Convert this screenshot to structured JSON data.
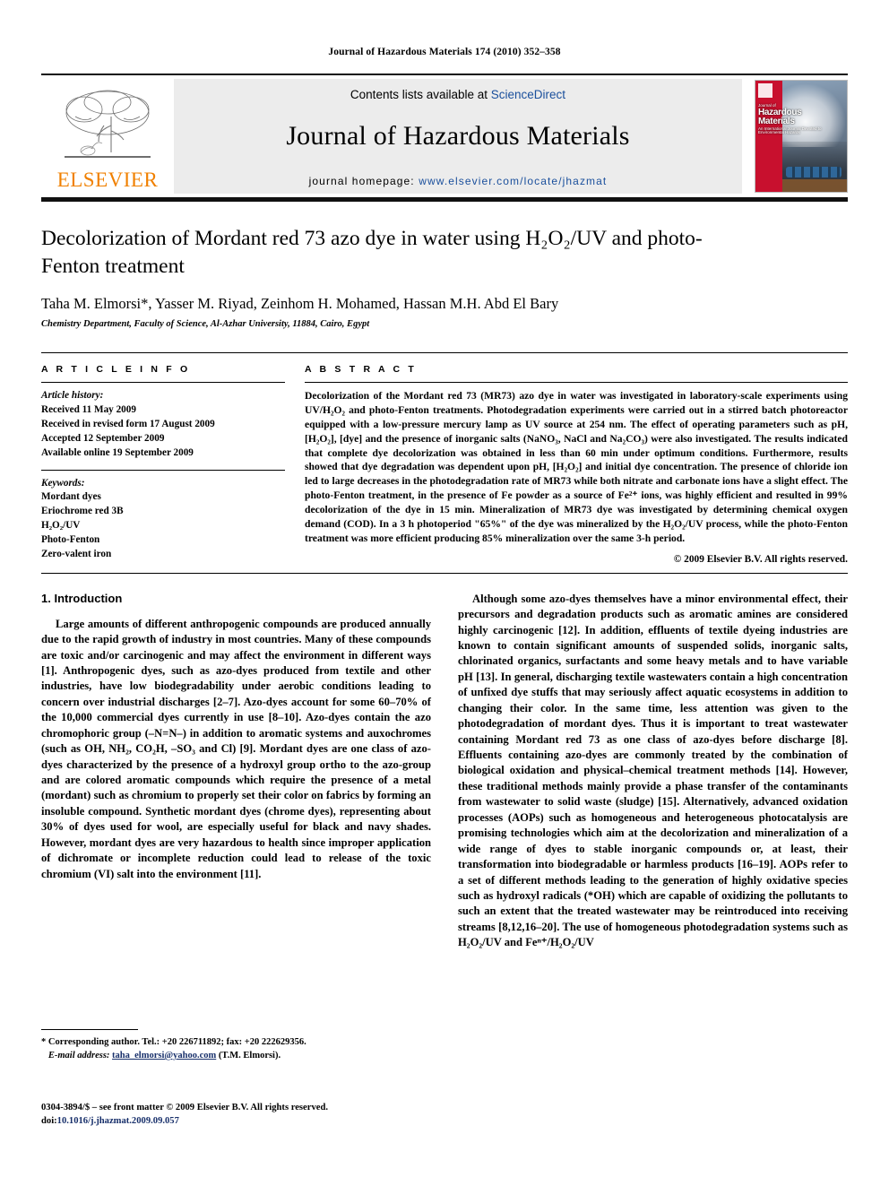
{
  "running_head": "Journal of Hazardous Materials 174 (2010) 352–358",
  "masthead": {
    "publisher_name": "ELSEVIER",
    "contents_prefix": "Contents lists available at",
    "contents_link": "ScienceDirect",
    "journal_title": "Journal of Hazardous Materials",
    "homepage_label": "journal homepage:",
    "homepage_url": "www.elsevier.com/locate/jhazmat",
    "cover_journal_of": "Journal of",
    "cover_line1": "Hazardous",
    "cover_line2": "Materials",
    "cover_sub": "An International Journal Devoted to Environmental Hazards",
    "link_color": "#1a4f9c",
    "elsevier_orange": "#f08000",
    "band_gray": "#ececec"
  },
  "article": {
    "title": "Decolorization of Mordant red 73 azo dye in water using H₂O₂/UV and photo-Fenton treatment",
    "authors": "Taha M. Elmorsi*, Yasser M. Riyad, Zeinhom H. Mohamed, Hassan M.H. Abd El Bary",
    "affiliation": "Chemistry Department, Faculty of Science, Al-Azhar University, 11884, Cairo, Egypt"
  },
  "info": {
    "heading": "A R T I C L E    I N F O",
    "history_label": "Article history:",
    "history": [
      "Received 11 May 2009",
      "Received in revised form 17 August 2009",
      "Accepted 12 September 2009",
      "Available online 19 September 2009"
    ],
    "keywords_label": "Keywords:",
    "keywords": [
      "Mordant dyes",
      "Eriochrome red 3B",
      "H₂O₂/UV",
      "Photo-Fenton",
      "Zero-valent iron"
    ]
  },
  "abstract": {
    "heading": "A B S T R A C T",
    "text": "Decolorization of the Mordant red 73 (MR73) azo dye in water was investigated in laboratory-scale experiments using UV/H₂O₂ and photo-Fenton treatments. Photodegradation experiments were carried out in a stirred batch photoreactor equipped with a low-pressure mercury lamp as UV source at 254 nm. The effect of operating parameters such as pH, [H₂O₂], [dye] and the presence of inorganic salts (NaNO₃, NaCl and Na₂CO₃) were also investigated. The results indicated that complete dye decolorization was obtained in less than 60 min under optimum conditions. Furthermore, results showed that dye degradation was dependent upon pH, [H₂O₂] and initial dye concentration. The presence of chloride ion led to large decreases in the photodegradation rate of MR73 while both nitrate and carbonate ions have a slight effect. The photo-Fenton treatment, in the presence of Fe powder as a source of Fe²⁺ ions, was highly efficient and resulted in 99% decolorization of the dye in 15 min. Mineralization of MR73 dye was investigated by determining chemical oxygen demand (COD). In a 3 h photoperiod \"65%\" of the dye was mineralized by the H₂O₂/UV process, while the photo-Fenton treatment was more efficient producing 85% mineralization over the same 3-h period.",
    "copyright": "© 2009 Elsevier B.V. All rights reserved."
  },
  "section": {
    "number_title": "1.  Introduction",
    "left_paragraph_1": "Large amounts of different anthropogenic compounds are produced annually due to the rapid growth of industry in most countries. Many of these compounds are toxic and/or carcinogenic and may affect the environment in different ways [1]. Anthropogenic dyes, such as azo-dyes produced from textile and other industries, have low biodegradability under aerobic conditions leading to concern over industrial discharges [2–7]. Azo-dyes account for some 60–70% of the 10,000 commercial dyes currently in use [8–10]. Azo-dyes contain the azo chromophoric group (–N=N–) in addition to aromatic systems and auxochromes (such as OH, NH₂, CO₂H, –SO₃ and Cl) [9]. Mordant dyes are one class of azo-dyes characterized by the presence of a hydroxyl group ortho to the azo-group and are colored aromatic compounds which require the presence of a metal (mordant) such as chromium to properly set their color on fabrics by forming an insoluble compound. Synthetic mordant dyes (chrome dyes), representing about 30% of dyes used for wool, are especially useful for black and navy shades. However, mordant dyes are very hazardous to health since improper application of dichromate or incomplete reduction could lead to release of the toxic chromium (VI) salt into the environment [11].",
    "right_paragraph_1": "Although some azo-dyes themselves have a minor environmental effect, their precursors and degradation products such as aromatic amines are considered highly carcinogenic [12]. In addition, effluents of textile dyeing industries are known to contain significant amounts of suspended solids, inorganic salts, chlorinated organics, surfactants and some heavy metals and to have variable pH [13]. In general, discharging textile wastewaters contain a high concentration of unfixed dye stuffs that may seriously affect aquatic ecosystems in addition to changing their color. In the same time, less attention was given to the photodegradation of mordant dyes. Thus it is important to treat wastewater containing Mordant red 73 as one class of azo-dyes before discharge [8]. Effluents containing azo-dyes are commonly treated by the combination of biological oxidation and physical–chemical treatment methods [14]. However, these traditional methods mainly provide a phase transfer of the contaminants from wastewater to solid waste (sludge) [15]. Alternatively, advanced oxidation processes (AOPs) such as homogeneous and heterogeneous photocatalysis are promising technologies which aim at the decolorization and mineralization of a wide range of dyes to stable inorganic compounds or, at least, their transformation into biodegradable or harmless products [16–19]. AOPs refer to a set of different methods leading to the generation of highly oxidative species such as hydroxyl radicals (*OH) which are capable of oxidizing the pollutants to such an extent that the treated wastewater may be reintroduced into receiving streams [8,12,16–20]. The use of homogeneous photodegradation systems such as H₂O₂/UV and Feⁿ⁺/H₂O₂/UV"
  },
  "footnote": {
    "corresponding": "*  Corresponding author. Tel.: +20 226711892; fax: +20 222629356.",
    "email_label": "E-mail address:",
    "email": "taha_elmorsi@yahoo.com",
    "email_suffix": "(T.M. Elmorsi)."
  },
  "imprint": {
    "issn_line": "0304-3894/$ – see front matter © 2009 Elsevier B.V. All rights reserved.",
    "doi_label": "doi:",
    "doi_value": "10.1016/j.jhazmat.2009.09.057"
  }
}
